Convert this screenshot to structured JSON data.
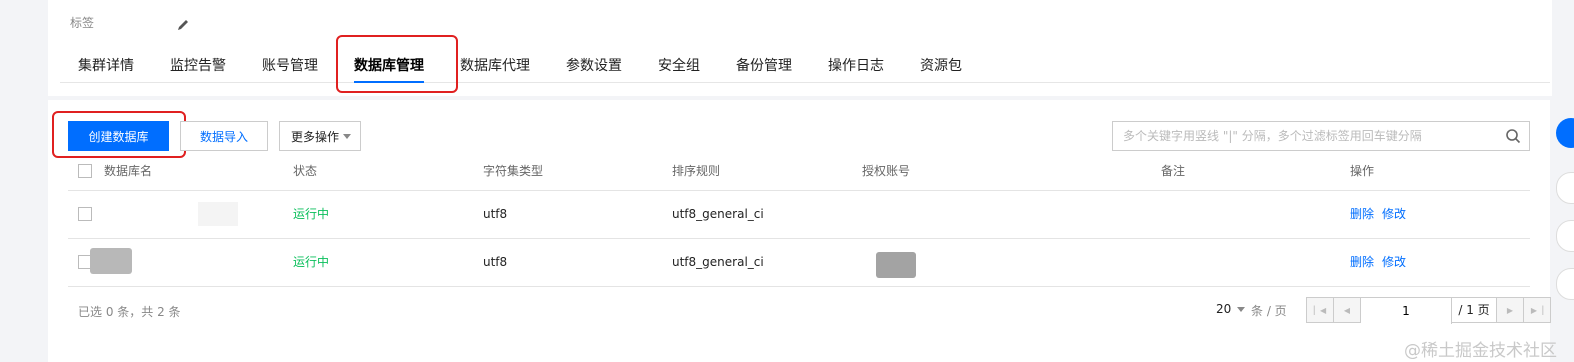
{
  "header": {
    "tag_label": "标签",
    "edit_icon": "pencil-icon"
  },
  "tabs": [
    {
      "label": "集群详情",
      "active": false
    },
    {
      "label": "监控告警",
      "active": false
    },
    {
      "label": "账号管理",
      "active": false
    },
    {
      "label": "数据库管理",
      "active": true
    },
    {
      "label": "数据库代理",
      "active": false
    },
    {
      "label": "参数设置",
      "active": false
    },
    {
      "label": "安全组",
      "active": false
    },
    {
      "label": "备份管理",
      "active": false
    },
    {
      "label": "操作日志",
      "active": false
    },
    {
      "label": "资源包",
      "active": false
    }
  ],
  "toolbar": {
    "create_label": "创建数据库",
    "import_label": "数据导入",
    "more_label": "更多操作",
    "search_placeholder": "多个关键字用竖线 \"|\" 分隔，多个过滤标签用回车键分隔"
  },
  "table": {
    "columns": [
      "数据库名",
      "状态",
      "字符集类型",
      "排序规则",
      "授权账号",
      "备注",
      "操作"
    ],
    "rows": [
      {
        "name": "",
        "status": "运行中",
        "charset": "utf8",
        "collation": "utf8_general_ci",
        "account": "",
        "remark": "",
        "delete": "删除",
        "modify": "修改"
      },
      {
        "name": "",
        "status": "运行中",
        "charset": "utf8",
        "collation": "utf8_general_ci",
        "account": "",
        "remark": "",
        "delete": "删除",
        "modify": "修改"
      }
    ]
  },
  "footer": {
    "selection_info": "已选 0 条，共 2 条",
    "page_size": "20",
    "per_page_label": "条 / 页",
    "current_page": "1",
    "total_pages": "/ 1 页"
  },
  "watermark": "@稀土掘金技术社区",
  "colors": {
    "primary": "#006eff",
    "running": "#0abf5b",
    "highlight_box": "#e02020"
  }
}
